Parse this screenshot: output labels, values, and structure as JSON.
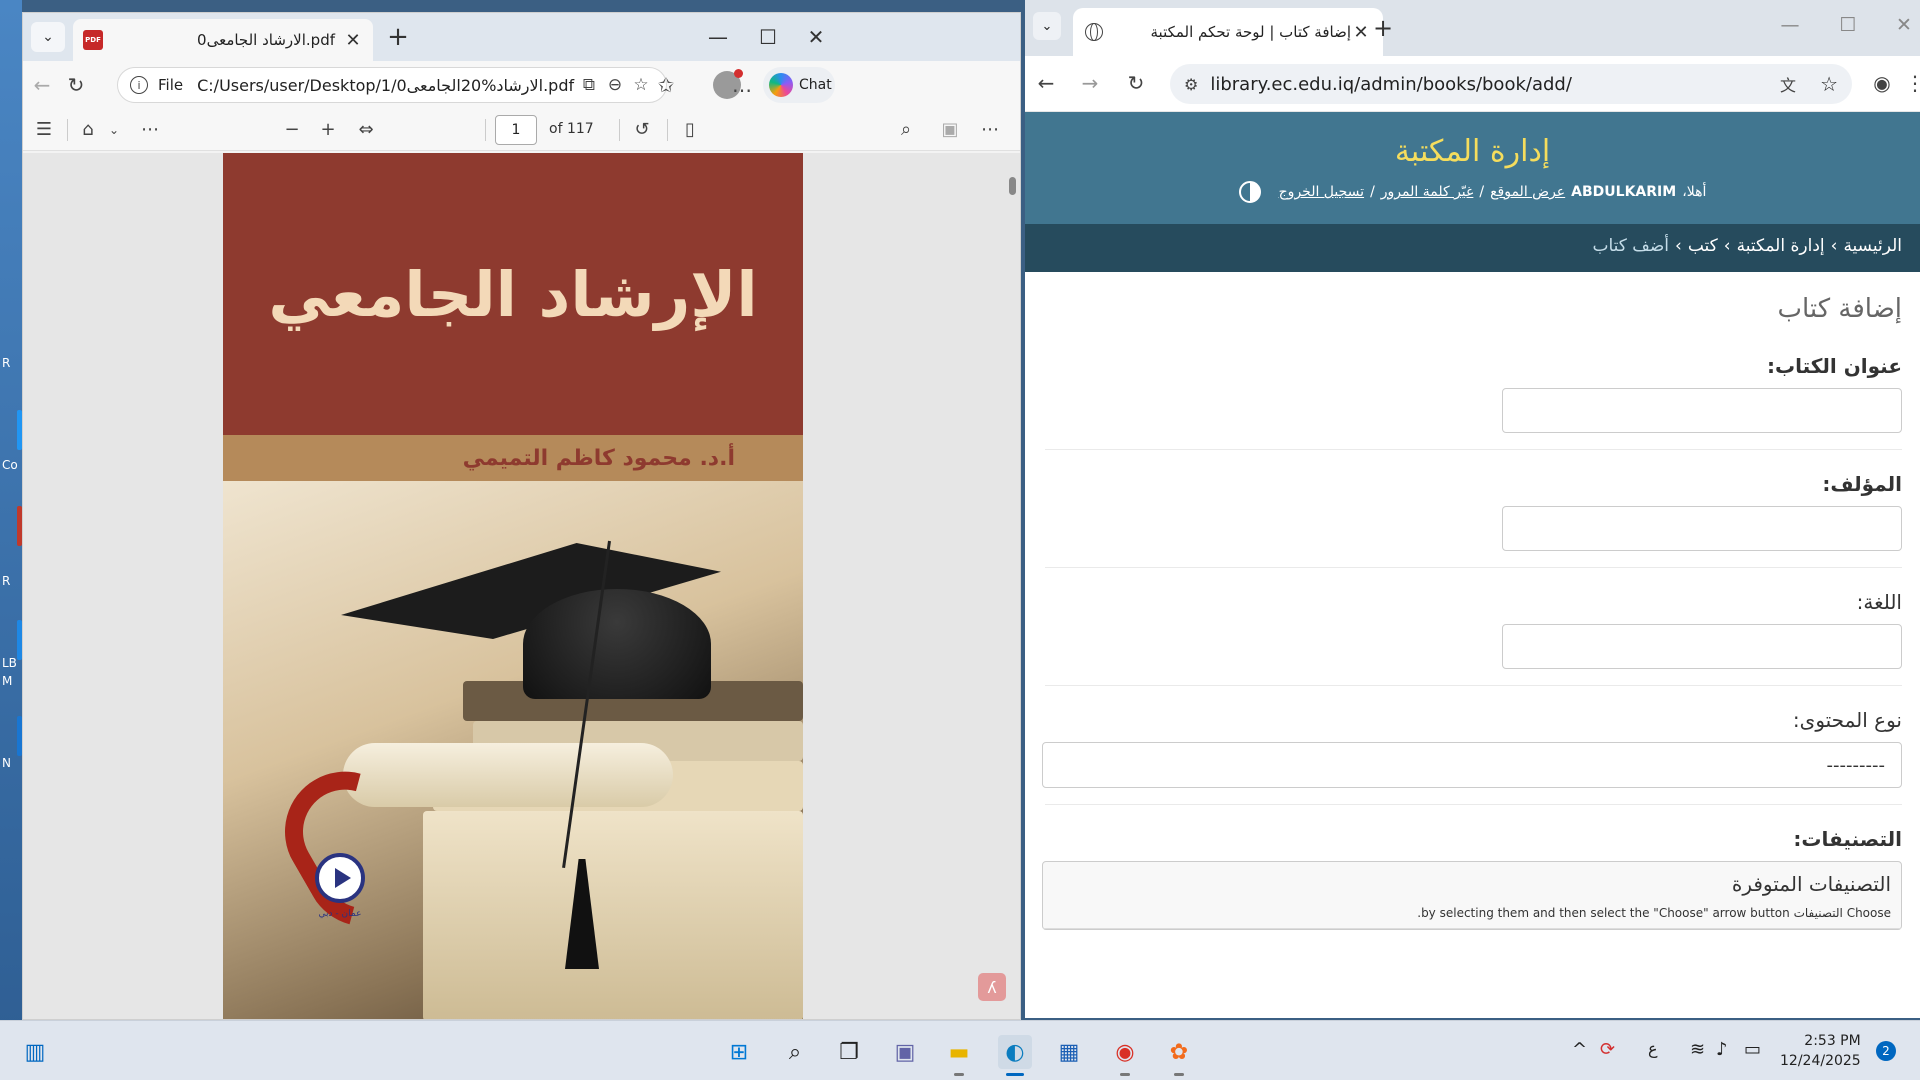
{
  "desktop": {
    "labels": [
      "R",
      "Co",
      "R",
      "LB",
      "M",
      "N"
    ]
  },
  "edge": {
    "tab_title": "الارشاد الجامعى0.pdf",
    "address_scheme": "File",
    "address_path": "C:/Users/user/Desktop/1/0الارشاد%20الجامعى.pdf",
    "copilot_label": "Chat",
    "pdf": {
      "current_page": "1",
      "page_count": "of 117"
    },
    "cover": {
      "title": "الإرشاد الجامعي",
      "author": "أ.د. محمود كاظم التميمي",
      "publisher_city": "عمان - دبي"
    }
  },
  "chrome": {
    "tab_title": "إضافة كتاب | لوحة تحكم المكتبة",
    "url": "library.ec.edu.iq/admin/books/book/add/",
    "site_title": "إدارة المكتبة",
    "user_tools": {
      "welcome": "أهلا،",
      "username": "ABDULKARIM",
      "view_site": "عرض الموقع",
      "change_password": "غيّر كلمة المرور",
      "logout": "تسجيل الخروج",
      "separator": "/"
    },
    "breadcrumbs": {
      "home": "الرئيسية",
      "app": "إدارة المكتبة",
      "model": "كتب",
      "current": "أضف كتاب",
      "separator": "›"
    },
    "page_heading": "إضافة كتاب",
    "form": {
      "title_label": "عنوان الكتاب:",
      "author_label": "المؤلف:",
      "language_label": "اللغة:",
      "content_type_label": "نوع المحتوى:",
      "content_type_value": "---------",
      "categories_label": "التصنيفات:",
      "available_title": "التصنيفات المتوفرة",
      "available_help": "Choose التصنيفات by selecting them and then select the \"Choose\" arrow button."
    }
  },
  "taskbar": {
    "keyboard_lang": "ع",
    "time": "2:53 PM",
    "date": "12/24/2025",
    "notification_count": "2"
  },
  "colors": {
    "django_header": "#417690",
    "django_breadcrumbs": "#264b5d",
    "django_site_title": "#f5dd5d",
    "cover_red": "#8e3a2f"
  }
}
